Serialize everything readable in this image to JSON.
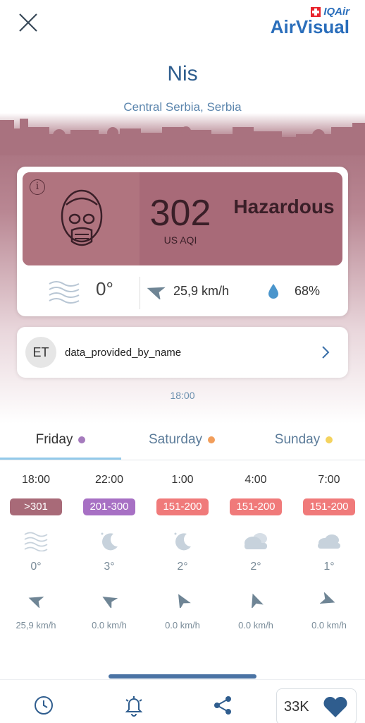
{
  "header": {
    "close_icon": "close-icon",
    "brand_top": "IQAir",
    "brand_bottom": "AirVisual"
  },
  "location": {
    "city": "Nis",
    "region": "Central Serbia, Serbia"
  },
  "aqi": {
    "value": "302",
    "unit": "US AQI",
    "level": "Hazardous",
    "color": "#a86a78"
  },
  "weather": {
    "temperature": "0°",
    "wind": "25,9 km/h",
    "humidity": "68%"
  },
  "provider": {
    "initials": "ET",
    "name": "data_provided_by_name"
  },
  "update_time": "18:00",
  "tabs": [
    {
      "label": "Friday",
      "dot_color": "#a57bbd"
    },
    {
      "label": "Saturday",
      "dot_color": "#f29e5b"
    },
    {
      "label": "Sunday",
      "dot_color": "#f4d35e"
    }
  ],
  "forecast": [
    {
      "time": "18:00",
      "aqi": ">301",
      "color": "#a86a78",
      "icon": "haze-icon",
      "temp": "0°",
      "wind": "25,9 km/h"
    },
    {
      "time": "22:00",
      "aqi": "201-300",
      "color": "#a770c4",
      "icon": "clear-night-icon",
      "temp": "3°",
      "wind": "0.0 km/h"
    },
    {
      "time": "1:00",
      "aqi": "151-200",
      "color": "#f07a7a",
      "icon": "clear-night-icon",
      "temp": "2°",
      "wind": "0.0 km/h"
    },
    {
      "time": "4:00",
      "aqi": "151-200",
      "color": "#f07a7a",
      "icon": "cloudy-icon",
      "temp": "2°",
      "wind": "0.0 km/h"
    },
    {
      "time": "7:00",
      "aqi": "151-200",
      "color": "#f07a7a",
      "icon": "cloud-icon",
      "temp": "1°",
      "wind": "0.0 km/h"
    }
  ],
  "bottom_bar": {
    "like_count": "33K"
  }
}
